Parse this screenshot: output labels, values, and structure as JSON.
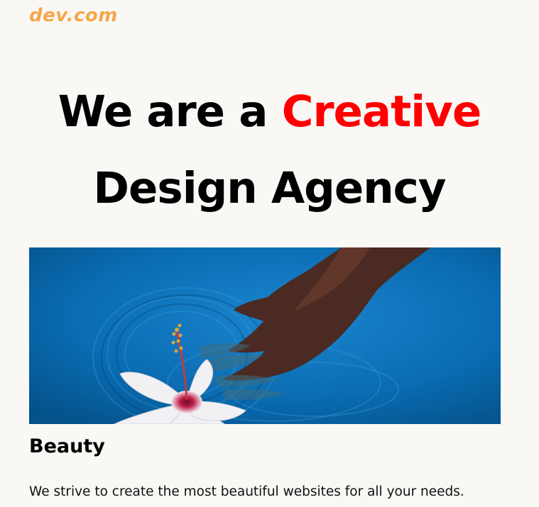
{
  "header": {
    "logo_text": "dev.com"
  },
  "hero": {
    "title_part1": "We are a ",
    "title_accent": "Creative",
    "title_line2": "Design Agency",
    "accent_color": "#ff0000"
  },
  "image": {
    "alt": "hand touching water with hibiscus flower"
  },
  "card": {
    "title": "Beauty",
    "description": "We strive to create the most beautiful websites for all your needs."
  },
  "colors": {
    "logo": "#f6a74a",
    "background": "#f9f8f5",
    "water": "#0a6cb2"
  }
}
